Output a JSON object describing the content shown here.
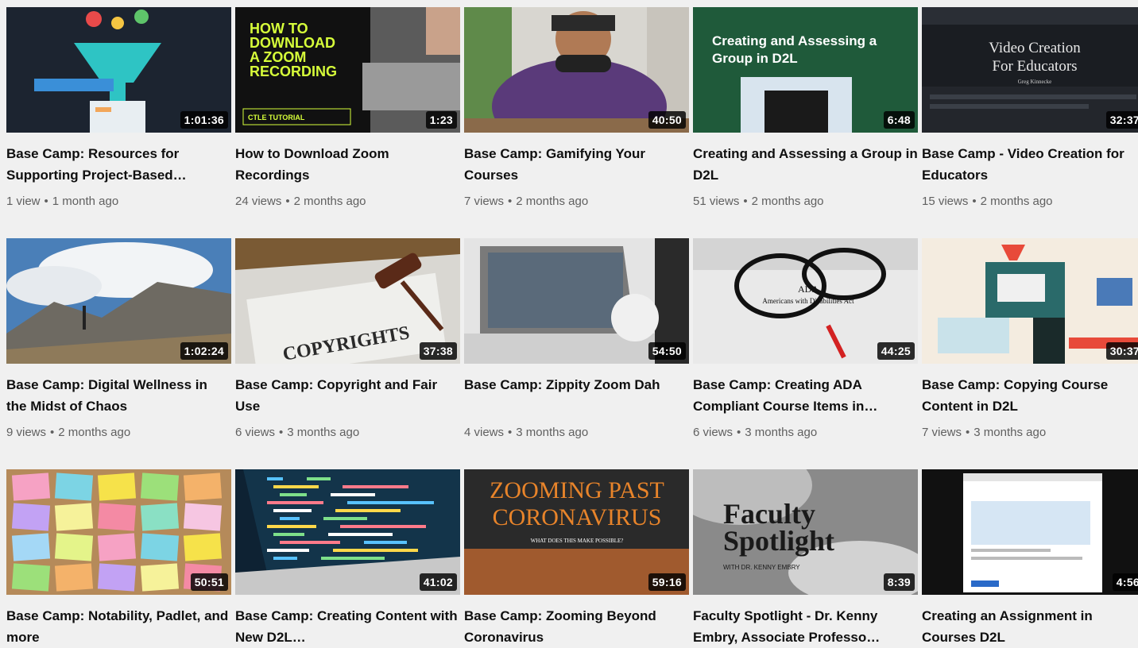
{
  "videos": [
    {
      "title": "Base Camp: Resources for Supporting Project-Based…",
      "duration": "1:01:36",
      "views": "1 view",
      "age": "1 month ago",
      "thumb": "funnel",
      "bg": "#1c2430"
    },
    {
      "title": "How to Download Zoom Recordings",
      "duration": "1:23",
      "views": "24 views",
      "age": "2 months ago",
      "thumb": "zoom-download",
      "bg": "#111111",
      "text": "HOW TO DOWNLOAD A ZOOM RECORDING",
      "subtext": "CTLE TUTORIAL"
    },
    {
      "title": "Base Camp: Gamifying Your Courses",
      "duration": "40:50",
      "views": "7 views",
      "age": "2 months ago",
      "thumb": "gamer",
      "bg": "#d8d6d0"
    },
    {
      "title": "Creating and Assessing a Group in D2L",
      "duration": "6:48",
      "views": "51 views",
      "age": "2 months ago",
      "thumb": "d2l-group",
      "bg": "#1f5a3a",
      "text": "Creating and Assessing a Group in D2L"
    },
    {
      "title": "Base Camp - Video Creation for Educators",
      "duration": "32:37",
      "views": "15 views",
      "age": "2 months ago",
      "thumb": "video-creation",
      "bg": "#1a1d22",
      "text": "Video Creation For Educators",
      "subtext": "Greg Kinnecke"
    },
    {
      "title": "Base Camp: Digital Wellness in the Midst of Chaos",
      "duration": "1:02:24",
      "views": "9 views",
      "age": "2 months ago",
      "thumb": "mountain",
      "bg": "#4a7fb8"
    },
    {
      "title": "Base Camp: Copyright and Fair Use",
      "duration": "37:38",
      "views": "6 views",
      "age": "3 months ago",
      "thumb": "copyright",
      "bg": "#7a5a34",
      "text": "COPYRIGHTS"
    },
    {
      "title": "Base Camp: Zippity Zoom Dah",
      "duration": "54:50",
      "views": "4 views",
      "age": "3 months ago",
      "thumb": "laptop-zoom",
      "bg": "#e4e4e4"
    },
    {
      "title": "Base Camp: Creating ADA Compliant Course Items in…",
      "duration": "44:25",
      "views": "6 views",
      "age": "3 months ago",
      "thumb": "ada",
      "bg": "#e9e9e9",
      "text": "ADA",
      "subtext": "Americans with Disabilities Act"
    },
    {
      "title": "Base Camp: Copying Course Content in D2L",
      "duration": "30:37",
      "views": "7 views",
      "age": "3 months ago",
      "thumb": "machine",
      "bg": "#f4ece0"
    },
    {
      "title": "Base Camp: Notability, Padlet, and more",
      "duration": "50:51",
      "views": "",
      "age": "",
      "thumb": "notes",
      "bg": "#b58a5a"
    },
    {
      "title": "Base Camp: Creating Content with New D2L…",
      "duration": "41:02",
      "views": "",
      "age": "",
      "thumb": "code",
      "bg": "#0e2233"
    },
    {
      "title": "Base Camp: Zooming Beyond Coronavirus",
      "duration": "59:16",
      "views": "",
      "age": "",
      "thumb": "zooming-past",
      "bg": "#2a2a2a",
      "text": "ZOOMING PAST CORONAVIRUS",
      "subtext": "WHAT DOES THIS MAKE POSSIBLE?"
    },
    {
      "title": "Faculty Spotlight - Dr. Kenny Embry, Associate Professo…",
      "duration": "8:39",
      "views": "",
      "age": "",
      "thumb": "faculty",
      "bg": "#8a8a8a",
      "text": "Faculty Spotlight",
      "subtext": "WITH DR. KENNY EMBRY"
    },
    {
      "title": "Creating an Assignment in Courses D2L",
      "duration": "4:56",
      "views": "",
      "age": "",
      "thumb": "assignment",
      "bg": "#111111"
    }
  ]
}
